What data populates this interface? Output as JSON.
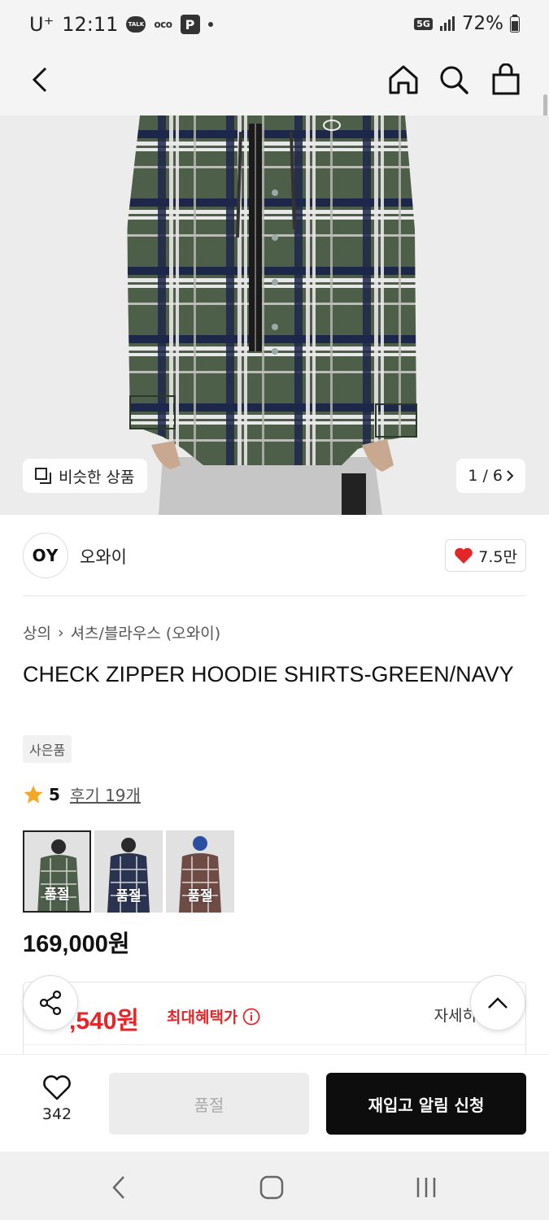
{
  "status": {
    "carrier": "U⁺",
    "time": "12:11",
    "talk_label": "TALK",
    "oco_label": "oco",
    "p_label": "P",
    "network": "5G",
    "battery": "72%"
  },
  "header": {
    "back_icon": "chevron-left-icon",
    "home_icon": "home-icon",
    "search_icon": "search-icon",
    "cart_icon": "shopping-bag-icon"
  },
  "hero": {
    "similar_label": "비슷한 상품",
    "counter": "1 / 6"
  },
  "brand": {
    "logo_text": "OY",
    "name": "오와이",
    "likes": "7.5만"
  },
  "product": {
    "breadcrumb": [
      "상의",
      "셔츠/블라우스 (오와이)"
    ],
    "title": "CHECK ZIPPER HOODIE SHIRTS-GREEN/NAVY",
    "gift_badge": "사은품",
    "rating": "5",
    "reviews": "후기 19개",
    "price": "169,000원",
    "variants": [
      {
        "label": "품절",
        "color": "#4d5e4b"
      },
      {
        "label": "품절",
        "color": "#2a3350"
      },
      {
        "label": "품절",
        "color": "#6e4b45"
      }
    ]
  },
  "benefit": {
    "price_visible": ",540원",
    "label": "최대혜택가",
    "detail": "자세히"
  },
  "bottom": {
    "wish_count": "342",
    "soldout_label": "품절",
    "restock_label": "재입고 알림 신청"
  },
  "colors": {
    "accent_red": "#e52629",
    "primary_black": "#0d0d0d"
  }
}
